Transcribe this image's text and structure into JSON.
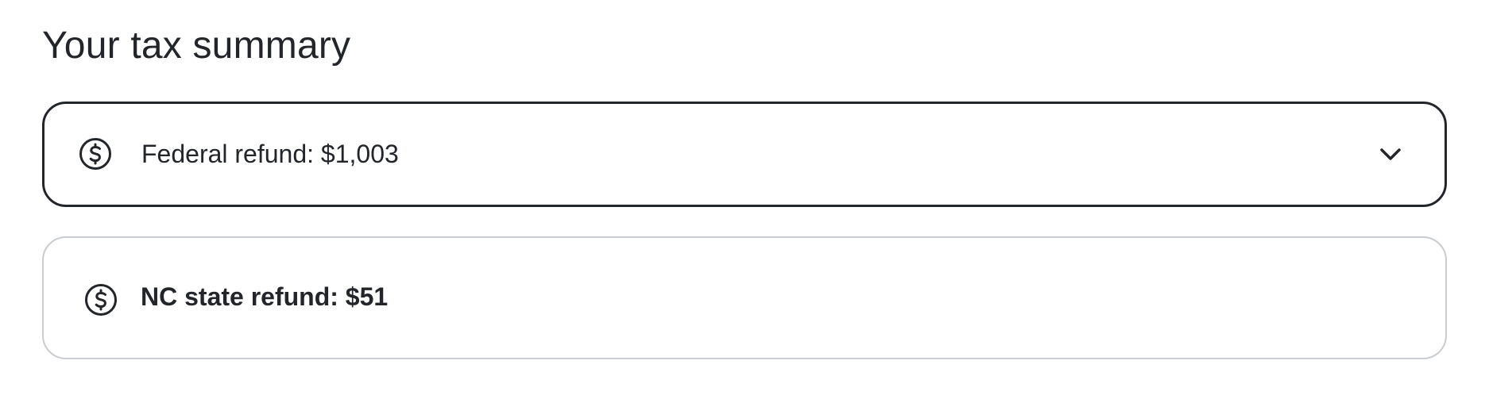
{
  "page": {
    "title": "Your tax summary"
  },
  "refunds": [
    {
      "label": "Federal refund: $1,003",
      "icon": "dollar-circle-icon",
      "expandable": true,
      "expand_icon": "chevron-down-icon"
    },
    {
      "label": "NC state refund: $51",
      "icon": "dollar-circle-icon",
      "expandable": false
    }
  ],
  "colors": {
    "text": "#22262b",
    "active_border": "#22262b",
    "inactive_border": "#c9cdd1",
    "background": "#ffffff"
  }
}
